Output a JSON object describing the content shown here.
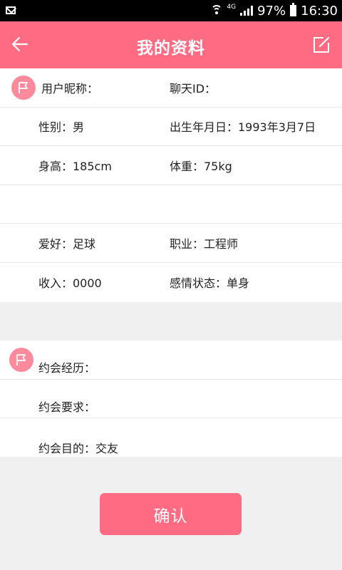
{
  "status_bar": {
    "battery": "97%",
    "time": "16:30",
    "network": "4G"
  },
  "header": {
    "title": "我的资料",
    "back_icon": "arrow-left-icon",
    "edit_icon": "edit-icon"
  },
  "basic_info": {
    "rows": [
      {
        "left": "用户昵称：",
        "right": "聊天ID："
      },
      {
        "left": "性别：男",
        "right": "出生年月日：1993年3月7日"
      },
      {
        "left": "身高：185cm",
        "right": "体重：75kg"
      },
      {
        "left": "",
        "right": ""
      },
      {
        "left": "爱好：足球",
        "right": "职业：工程师"
      },
      {
        "left": "收入：0000",
        "right": "感情状态：单身"
      }
    ]
  },
  "date_info": {
    "rows": [
      {
        "text": "约会经历："
      },
      {
        "text": "约会要求："
      },
      {
        "text": "约会目的：交友"
      }
    ]
  },
  "confirm_label": "确认",
  "colors": {
    "accent": "#ff6b82",
    "badge": "#ff8a9c",
    "background": "#f0f0f0"
  }
}
